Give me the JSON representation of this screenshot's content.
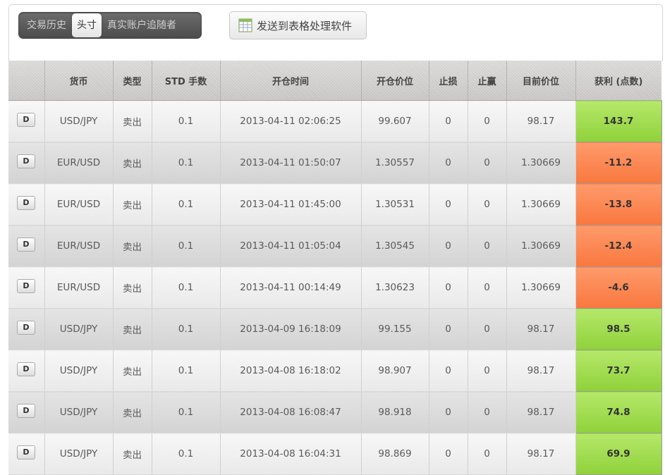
{
  "tabs": [
    {
      "label": "交易历史",
      "active": false
    },
    {
      "label": "头寸",
      "active": true
    },
    {
      "label": "真实账户追随者",
      "active": false
    }
  ],
  "export_button": {
    "label": "发送到表格处理软件",
    "icon": "spreadsheet-icon"
  },
  "table": {
    "headers": [
      "",
      "货币",
      "类型",
      "STD 手数",
      "开仓时间",
      "开仓价位",
      "止损",
      "止赢",
      "目前价位",
      "获利 (点数)"
    ],
    "detail_label": "D",
    "rows": [
      {
        "currency": "USD/JPY",
        "type": "卖出",
        "lots": "0.1",
        "open_time": "2013-04-11 02:06:25",
        "open_price": "99.607",
        "sl": "0",
        "tp": "0",
        "current": "98.17",
        "profit": "143.7",
        "profit_status": "positive"
      },
      {
        "currency": "EUR/USD",
        "type": "卖出",
        "lots": "0.1",
        "open_time": "2013-04-11 01:50:07",
        "open_price": "1.30557",
        "sl": "0",
        "tp": "0",
        "current": "1.30669",
        "profit": "-11.2",
        "profit_status": "negative"
      },
      {
        "currency": "EUR/USD",
        "type": "卖出",
        "lots": "0.1",
        "open_time": "2013-04-11 01:45:00",
        "open_price": "1.30531",
        "sl": "0",
        "tp": "0",
        "current": "1.30669",
        "profit": "-13.8",
        "profit_status": "negative"
      },
      {
        "currency": "EUR/USD",
        "type": "卖出",
        "lots": "0.1",
        "open_time": "2013-04-11 01:05:04",
        "open_price": "1.30545",
        "sl": "0",
        "tp": "0",
        "current": "1.30669",
        "profit": "-12.4",
        "profit_status": "negative"
      },
      {
        "currency": "EUR/USD",
        "type": "卖出",
        "lots": "0.1",
        "open_time": "2013-04-11 00:14:49",
        "open_price": "1.30623",
        "sl": "0",
        "tp": "0",
        "current": "1.30669",
        "profit": "-4.6",
        "profit_status": "negative"
      },
      {
        "currency": "USD/JPY",
        "type": "卖出",
        "lots": "0.1",
        "open_time": "2013-04-09 16:18:09",
        "open_price": "99.155",
        "sl": "0",
        "tp": "0",
        "current": "98.17",
        "profit": "98.5",
        "profit_status": "positive"
      },
      {
        "currency": "USD/JPY",
        "type": "卖出",
        "lots": "0.1",
        "open_time": "2013-04-08 16:18:02",
        "open_price": "98.907",
        "sl": "0",
        "tp": "0",
        "current": "98.17",
        "profit": "73.7",
        "profit_status": "positive"
      },
      {
        "currency": "USD/JPY",
        "type": "卖出",
        "lots": "0.1",
        "open_time": "2013-04-08 16:08:47",
        "open_price": "98.918",
        "sl": "0",
        "tp": "0",
        "current": "98.17",
        "profit": "74.8",
        "profit_status": "positive"
      },
      {
        "currency": "USD/JPY",
        "type": "卖出",
        "lots": "0.1",
        "open_time": "2013-04-08 16:04:31",
        "open_price": "98.869",
        "sl": "0",
        "tp": "0",
        "current": "98.17",
        "profit": "69.9",
        "profit_status": "positive"
      }
    ]
  },
  "colors": {
    "positive": "#9ddc4f",
    "negative": "#fb8550"
  }
}
